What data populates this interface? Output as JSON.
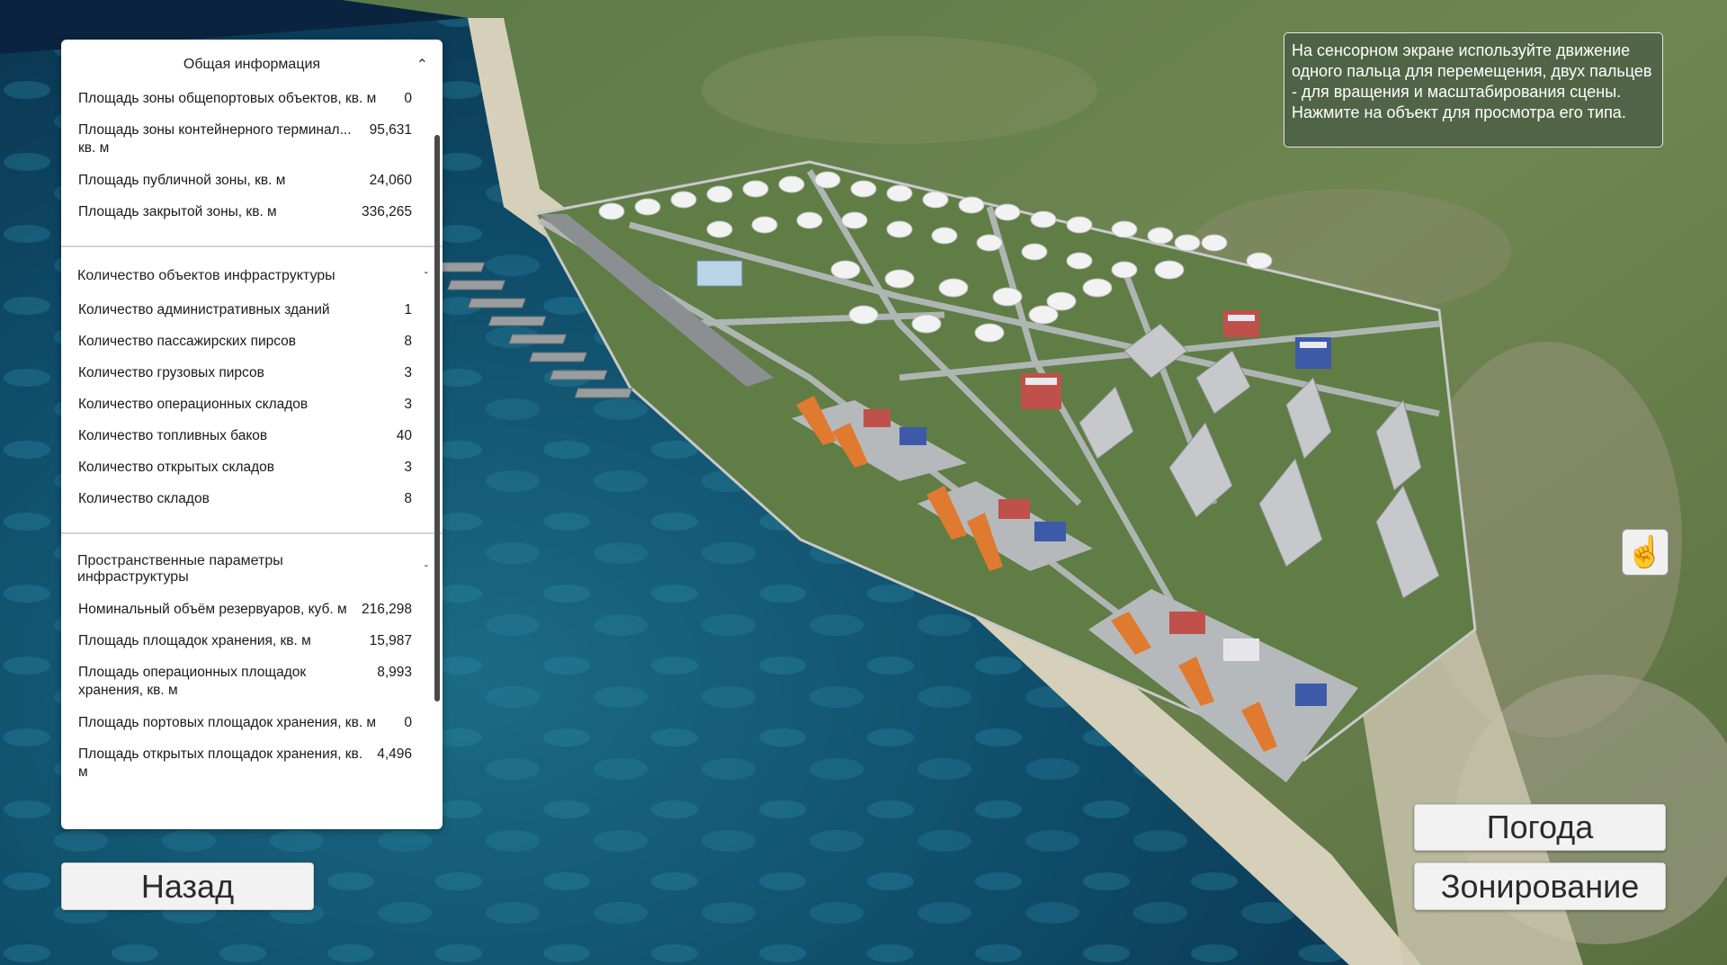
{
  "panel": {
    "sections": [
      {
        "title": "Общая информация",
        "rows": [
          {
            "label": "Площадь зоны общепортовых объектов, кв. м",
            "value": "0"
          },
          {
            "label": "Площадь зоны контейнерного терминал... кв. м",
            "value": "95,631"
          },
          {
            "label": "Площадь публичной зоны, кв. м",
            "value": "24,060"
          },
          {
            "label": "Площадь закрытой зоны, кв. м",
            "value": "336,265"
          }
        ]
      },
      {
        "title": "Количество объектов инфраструктуры",
        "rows": [
          {
            "label": "Количество административных зданий",
            "value": "1"
          },
          {
            "label": "Количество пассажирских пирсов",
            "value": "8"
          },
          {
            "label": "Количество грузовых пирсов",
            "value": "3"
          },
          {
            "label": "Количество операционных складов",
            "value": "3"
          },
          {
            "label": "Количество топливных баков",
            "value": "40"
          },
          {
            "label": "Количество открытых складов",
            "value": "3"
          },
          {
            "label": "Количество складов",
            "value": "8"
          }
        ]
      },
      {
        "title": "Пространственные параметры инфраструктуры",
        "rows": [
          {
            "label": "Номинальный объём резервуаров, куб. м",
            "value": "216,298"
          },
          {
            "label": "Площадь площадок хранения, кв. м",
            "value": "15,987"
          },
          {
            "label": "Площадь операционных площадок хранения, кв. м",
            "value": "8,993"
          },
          {
            "label": "Площадь портовых площадок хранения, кв. м",
            "value": "0"
          },
          {
            "label": "Площадь открытых площадок хранения, кв. м",
            "value": "4,496"
          }
        ]
      }
    ]
  },
  "hint": {
    "text": "На сенсорном экране используйте движение одного пальца для перемещения, двух пальцев - для вращения и масштабирования сцены. Нажмите на объект для просмотра его типа."
  },
  "buttons": {
    "back": "Назад",
    "weather": "Погода",
    "zoning": "Зонирование"
  },
  "icons": {
    "hand": "pointer-hand-icon"
  },
  "colors": {
    "sea": "#0e4a66",
    "land": "#4f6f3c",
    "beach": "#d6d0bb",
    "port_ground": "#5f7d45",
    "crane": "#e07a30"
  }
}
